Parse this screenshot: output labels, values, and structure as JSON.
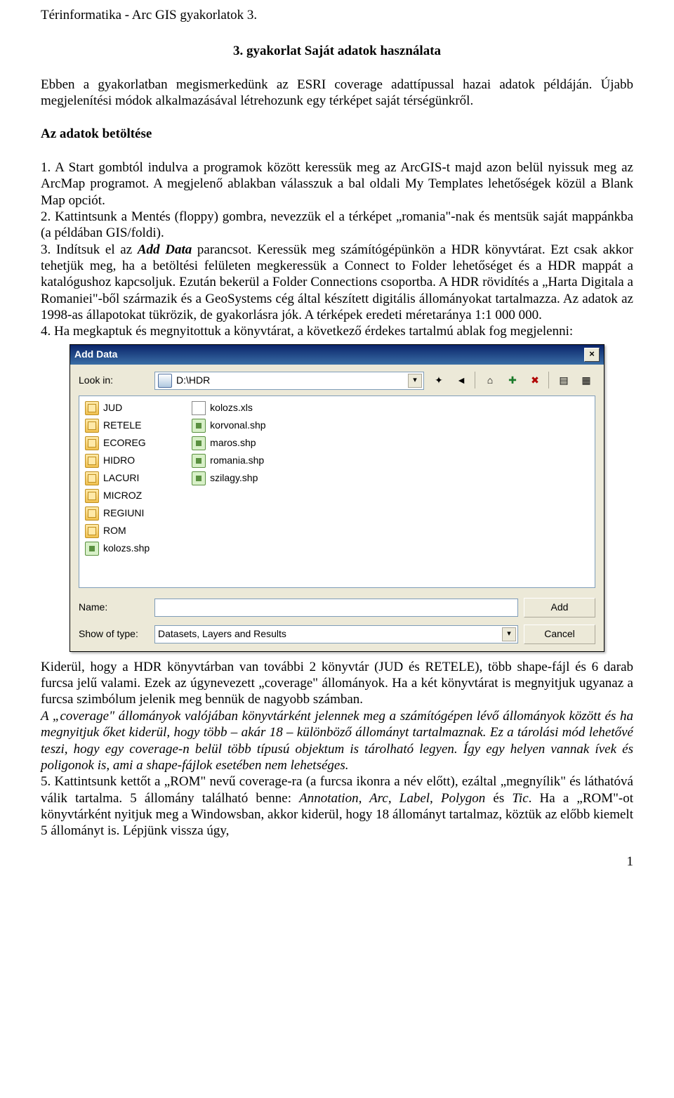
{
  "header": "Térinformatika - Arc GIS gyakorlatok 3.",
  "title": "3. gyakorlat Saját adatok használata",
  "intro": "Ebben a gyakorlatban megismerkedünk az ESRI coverage adattípussal hazai adatok példáján. Újabb megjelenítési módok alkalmazásával létrehozunk egy térképet saját térségünkről.",
  "subhead": "Az adatok betöltése",
  "list_1_pre": "1. A Start gombtól indulva a programok között keressük meg az ArcGIS-t majd azon belül nyissuk meg az ArcMap programot. A megjelenő ablakban válasszuk a bal oldali My Templates lehetőségek közül a Blank Map opciót.",
  "list_2": "2. Kattintsunk a Mentés (floppy) gombra, nevezzük el a térképet „romania\"-nak és mentsük saját mappánkba (a példában GIS/foldi).",
  "list_3_a": "3. Indítsuk el az ",
  "list_3_add": "Add Data",
  "list_3_b": " parancsot. Keressük meg számítógépünkön a HDR könyvtárat. Ezt csak akkor tehetjük meg, ha a betöltési felületen megkeressük a Connect to Folder lehetőséget és a HDR mappát a katalógushoz kapcsoljuk. Ezután bekerül a Folder Connections csoportba. A HDR rövidítés a „Harta Digitala a Romaniei\"-ből származik és a GeoSystems cég által készített digitális állományokat tartalmazza. Az adatok az 1998-as állapotokat tükrözik, de gyakorlásra jók. A térképek eredeti méretaránya 1:1 000 000.",
  "list_4": "4. Ha megkaptuk és megnyitottuk a könyvtárat, a következő érdekes tartalmú ablak fog megjelenni:",
  "dialog": {
    "title": "Add Data",
    "lookin_label": "Look in:",
    "lookin_value": "D:\\HDR",
    "col1": [
      "JUD",
      "RETELE",
      "ECOREG",
      "HIDRO",
      "LACURI",
      "MICROZ",
      "REGIUNI",
      "ROM",
      "kolozs.shp"
    ],
    "col1_types": [
      "cov",
      "cov",
      "cov",
      "cov",
      "cov",
      "cov",
      "cov",
      "cov",
      "shp"
    ],
    "col2": [
      "kolozs.xls",
      "korvonal.shp",
      "maros.shp",
      "romania.shp",
      "szilagy.shp"
    ],
    "col2_types": [
      "xls",
      "shp",
      "shp",
      "shp",
      "shp"
    ],
    "name_label": "Name:",
    "name_value": "",
    "show_label": "Show of type:",
    "show_value": "Datasets, Layers and Results",
    "add_btn": "Add",
    "cancel_btn": "Cancel"
  },
  "after_a": "Kiderül, hogy a HDR könyvtárban van további 2 könyvtár (JUD és RETELE), több shape-fájl és 6 darab furcsa jelű valami. Ezek az úgynevezett „coverage\" állományok. Ha a két könyvtárat is megnyitjuk ugyanaz a furcsa szimbólum jelenik meg bennük de nagyobb számban.",
  "after_italic": "A „coverage\" állományok valójában könyvtárként jelennek meg a számítógépen lévő állományok között és ha megnyitjuk őket kiderül, hogy több – akár 18 – különböző állományt tartalmaznak. Ez a tárolási mód lehetővé teszi, hogy egy coverage-n belül több típusú objektum is tárolható legyen. Így egy helyen vannak ívek és poligonok is, ami a shape-fájlok esetében nem lehetséges.",
  "list_5_a": "5. Kattintsunk kettőt a „ROM\" nevű coverage-ra (a furcsa ikonra a név előtt), ezáltal „megnyílik\" és láthatóvá válik tartalma. 5 állomány található benne: ",
  "list_5_em": "Annotation, Arc, Label, Polygon",
  "list_5_mid": " és ",
  "list_5_em2": "Tic",
  "list_5_b": ". Ha a „ROM\"-ot könyvtárként nyitjuk meg a Windowsban, akkor kiderül, hogy 18 állományt tartalmaz, köztük az előbb kiemelt 5 állományt is. Lépjünk vissza úgy,",
  "page_num": "1"
}
